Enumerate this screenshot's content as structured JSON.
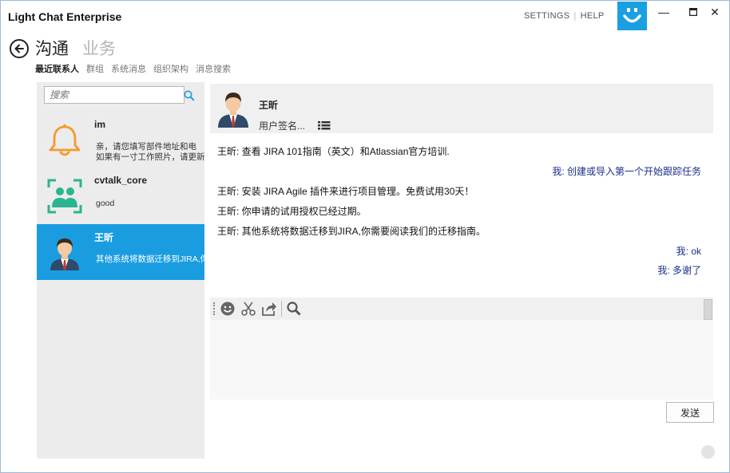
{
  "app": {
    "title": "Light Chat Enterprise",
    "settings_label": "SETTINGS",
    "help_label": "HELP",
    "logo_icon": "smiley-logo-icon",
    "accent_color": "#1a9de0"
  },
  "window_controls": {
    "minimize": "—",
    "maximize": "☐",
    "close": "✕"
  },
  "nav": {
    "main": "沟通",
    "secondary": "业务",
    "tabs": [
      {
        "label": "最近联系人",
        "active": true
      },
      {
        "label": "群组"
      },
      {
        "label": "系统消息"
      },
      {
        "label": "组织架构"
      },
      {
        "label": "消息搜索"
      }
    ]
  },
  "search": {
    "placeholder": "搜索"
  },
  "contacts": [
    {
      "name": "im",
      "icon": "bell-icon",
      "preview_line1": "亲，请您填写部件地址和电",
      "preview_line2": "如果有一寸工作照片，请更新"
    },
    {
      "name": "cvtalk_core",
      "icon": "group-icon",
      "preview_line1": "good"
    },
    {
      "name": "王昕",
      "icon": "person-avatar-icon",
      "preview_line1": "其他系统将数据迁移到JIRA,你",
      "selected": true
    }
  ],
  "chat": {
    "contact_name": "王昕",
    "signature": "用户签名...",
    "messages": [
      {
        "direction": "in",
        "text": "王昕: 查看 JIRA 101指南（英文）和Atlassian官方培训."
      },
      {
        "direction": "out",
        "text": "我: 创建或导入第一个开始跟踪任务"
      },
      {
        "direction": "in",
        "text": "王昕: 安装 JIRA Agile 插件来进行项目管理。免费试用30天！"
      },
      {
        "direction": "in",
        "text": "王昕: 你申请的试用授权已经过期。"
      },
      {
        "direction": "in",
        "text": "王昕: 其他系统将数据迁移到JIRA,你需要阅读我们的迁移指南。"
      },
      {
        "direction": "out",
        "text": "我: ok"
      },
      {
        "direction": "out",
        "text": "我: 多谢了"
      }
    ],
    "toolbar": [
      "emoji-icon",
      "scissors-icon",
      "share-icon",
      "search-icon"
    ],
    "input_value": "",
    "send_label": "发送"
  }
}
